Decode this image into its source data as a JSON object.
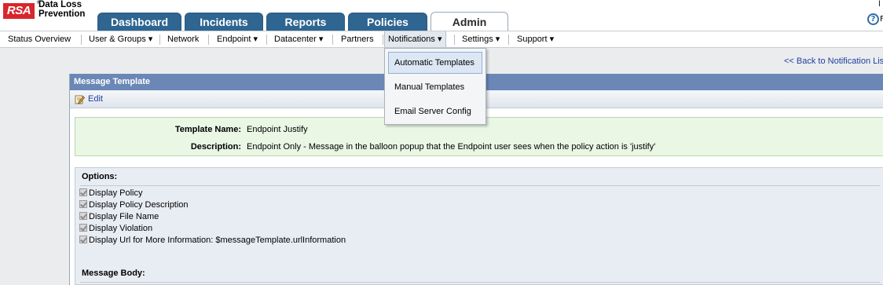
{
  "brand": {
    "logo_mark": "RSA",
    "line1": "Data Loss",
    "line2": "Prevention"
  },
  "corner": {
    "top": "l",
    "help_suffix": "F"
  },
  "tabs": [
    {
      "label": "Dashboard",
      "active": false
    },
    {
      "label": "Incidents",
      "active": false
    },
    {
      "label": "Reports",
      "active": false
    },
    {
      "label": "Policies",
      "active": false
    },
    {
      "label": "Admin",
      "active": true
    }
  ],
  "help_icon": "help-icon",
  "subnav": {
    "items": [
      {
        "label": "Status Overview",
        "caret": false
      },
      {
        "label": "User & Groups ▾",
        "caret": true
      },
      {
        "label": "Network",
        "caret": false
      },
      {
        "label": "Endpoint ▾",
        "caret": true
      },
      {
        "label": "Datacenter ▾",
        "caret": true
      },
      {
        "label": "Partners",
        "caret": false
      },
      {
        "label": "Notifications ▾",
        "caret": true,
        "open": true
      },
      {
        "label": "Settings ▾",
        "caret": true
      },
      {
        "label": "Support ▾",
        "caret": true
      }
    ]
  },
  "dropdown": {
    "items": [
      {
        "label": "Automatic Templates",
        "highlighted": true
      },
      {
        "label": "Manual Templates",
        "highlighted": false
      },
      {
        "label": "Email Server Config",
        "highlighted": false
      }
    ]
  },
  "back_link": "<< Back to Notification List",
  "panel": {
    "title": "Message Template",
    "edit_label": "Edit",
    "template_name_label": "Template Name:",
    "template_name_value": "Endpoint Justify",
    "description_label": "Description:",
    "description_value": "Endpoint Only - Message in the balloon popup that the Endpoint user sees when the policy action is 'justify'",
    "options_title": "Options:",
    "options": [
      {
        "label": "Display Policy",
        "checked": true
      },
      {
        "label": "Display Policy Description",
        "checked": true
      },
      {
        "label": "Display File Name",
        "checked": true
      },
      {
        "label": "Display Violation",
        "checked": true
      },
      {
        "label": "Display Url for More Information: $messageTemplate.urlInformation",
        "checked": true
      }
    ],
    "message_body_title": "Message Body:"
  },
  "colors": {
    "tab_blue": "#2e6591",
    "panel_header": "#6b87b6",
    "info_green": "#e9f7e4",
    "brand_red": "#d8262c"
  }
}
